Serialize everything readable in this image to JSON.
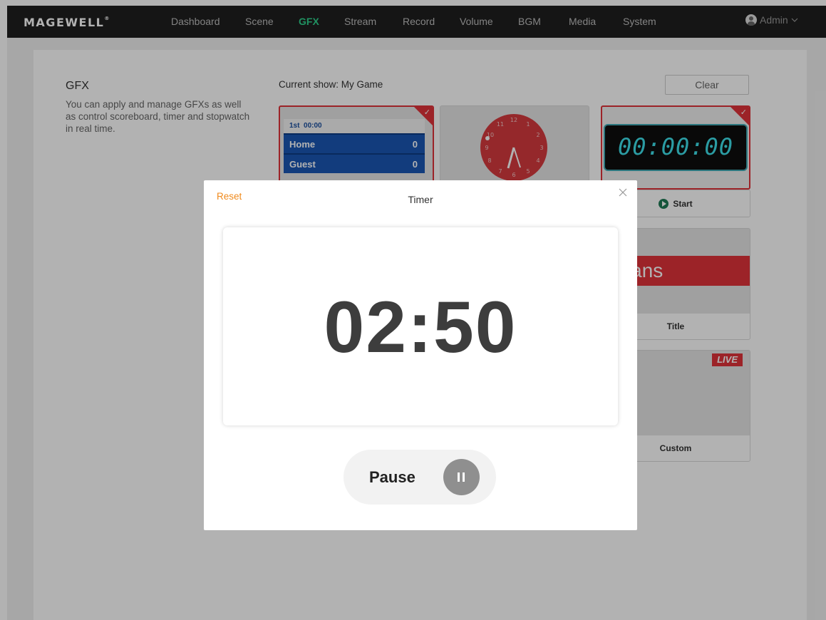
{
  "brand": {
    "logo": "MAGEWELL",
    "mark": "®"
  },
  "nav": {
    "items": [
      {
        "label": "Dashboard",
        "active": false
      },
      {
        "label": "Scene",
        "active": false
      },
      {
        "label": "GFX",
        "active": true
      },
      {
        "label": "Stream",
        "active": false
      },
      {
        "label": "Record",
        "active": false
      },
      {
        "label": "Volume",
        "active": false
      },
      {
        "label": "BGM",
        "active": false
      },
      {
        "label": "Media",
        "active": false
      },
      {
        "label": "System",
        "active": false
      }
    ],
    "user": "Admin"
  },
  "sidebar": {
    "title": "GFX",
    "description": "You can apply and manage GFXs as well as control scoreboard, timer and stopwatch in real time."
  },
  "gfx": {
    "current_show": "Current show: My Game",
    "clear_label": "Clear",
    "scoreboard": {
      "period": "1st",
      "clock": "00:00",
      "teams": [
        {
          "name": "Home",
          "score": "0"
        },
        {
          "name": "Guest",
          "score": "0"
        }
      ]
    },
    "timer_card": {
      "display": "00:00:00",
      "action": "Start"
    },
    "title_card": {
      "text": "son Hans",
      "label": "Title"
    },
    "custom_card": {
      "badge": "LIVE",
      "label": "Custom"
    }
  },
  "modal": {
    "reset_label": "Reset",
    "title": "Timer",
    "time": "02:50",
    "pause_label": "Pause"
  },
  "colors": {
    "accent": "#2fd08c",
    "selected": "#e0333a",
    "reset": "#f08a1c",
    "scoreboard": "#1b56b3",
    "clock_face": "#d63a3e"
  },
  "icons": {
    "close": "close-icon",
    "pause": "pause-icon",
    "start": "play-icon",
    "check": "check-icon",
    "user": "user-icon",
    "chevron": "chevron-down-icon"
  }
}
